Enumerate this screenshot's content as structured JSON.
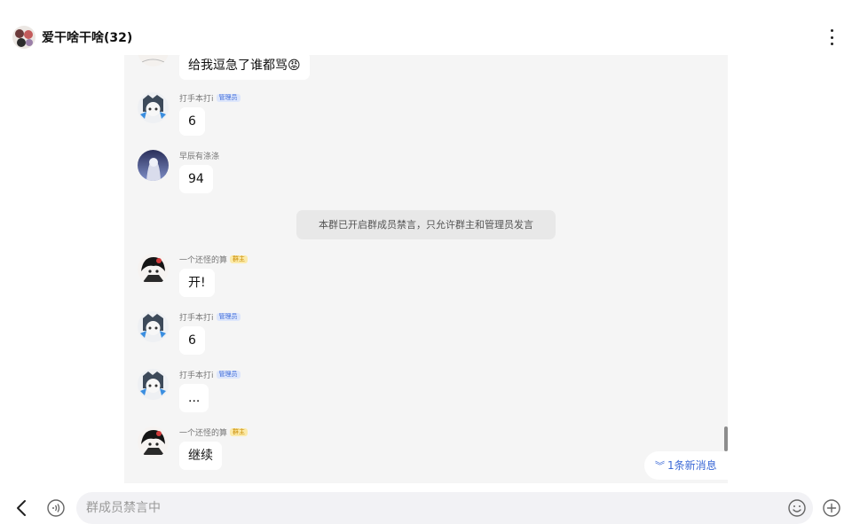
{
  "header": {
    "title": "爱干啥干啥(32)",
    "more_icon": "more-vertical-icon"
  },
  "messages": [
    {
      "sender": "",
      "badge": "",
      "text": "给我逗急了谁都骂😡"
    },
    {
      "sender": "打手本打i",
      "badge": "管理员",
      "text": "6"
    },
    {
      "sender": "早辰有涤涤",
      "badge": "",
      "text": "94"
    },
    {
      "sender": "一个还怪的算",
      "badge": "群主",
      "text": "开!"
    },
    {
      "sender": "打手本打i",
      "badge": "管理员",
      "text": "6"
    },
    {
      "sender": "打手本打i",
      "badge": "管理员",
      "text": "..."
    },
    {
      "sender": "一个还怪的算",
      "badge": "群主",
      "text": "继续"
    }
  ],
  "system_notice": "本群已开启群成员禁言，只允许群主和管理员发言",
  "new_messages": "1条新消息",
  "composer": {
    "placeholder": "群成员禁言中"
  },
  "icons": {
    "back": "back-arrow-icon",
    "voice": "voice-icon",
    "emoji": "emoji-icon",
    "plus": "plus-icon",
    "new_msg": "double-chevron-down-icon"
  },
  "colors": {
    "admin_badge": "#3f6cd8",
    "owner_badge": "#c98a00",
    "accent": "#3d6ad6",
    "chat_bg": "#f5f5f5"
  }
}
